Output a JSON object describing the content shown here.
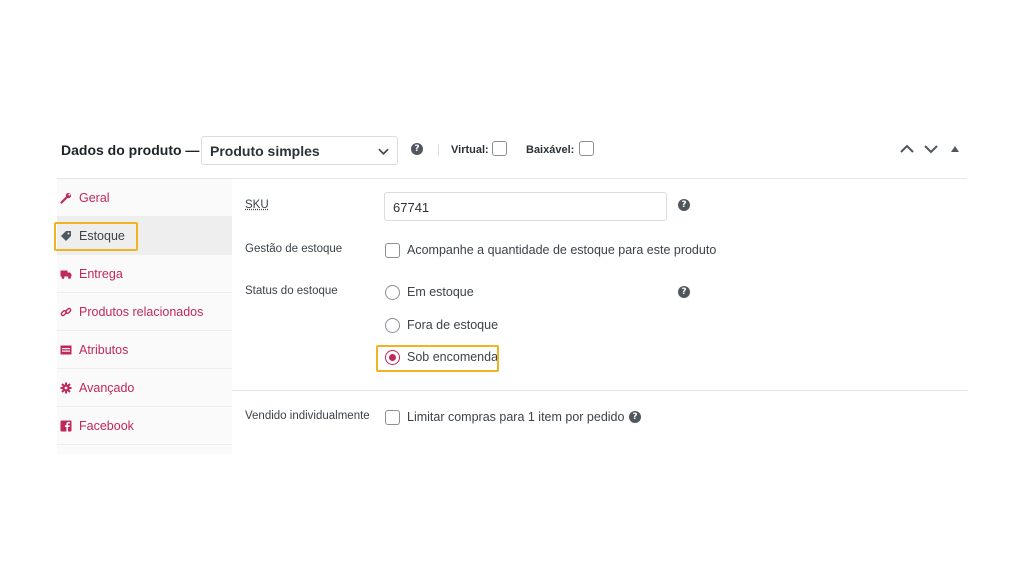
{
  "header": {
    "title": "Dados do produto —",
    "product_type": "Produto simples",
    "virtual_label": "Virtual:",
    "downloadable_label": "Baixável:",
    "help": "?"
  },
  "tabs": [
    {
      "label": "Geral",
      "icon": "wrench-icon",
      "active": false
    },
    {
      "label": "Estoque",
      "icon": "tag-icon",
      "active": true
    },
    {
      "label": "Entrega",
      "icon": "truck-icon",
      "active": false
    },
    {
      "label": "Produtos relacionados",
      "icon": "link-icon",
      "active": false
    },
    {
      "label": "Atributos",
      "icon": "table-icon",
      "active": false
    },
    {
      "label": "Avançado",
      "icon": "gear-icon",
      "active": false
    },
    {
      "label": "Facebook",
      "icon": "facebook-icon",
      "active": false
    }
  ],
  "inventory": {
    "sku_label": "SKU",
    "sku_value": "67741",
    "stock_mgmt_label": "Gestão de estoque",
    "stock_mgmt_text": "Acompanhe a quantidade de estoque para este produto",
    "stock_status_label": "Status do estoque",
    "status_options": [
      "Em estoque",
      "Fora de estoque",
      "Sob encomenda"
    ],
    "selected_status": "Sob encomenda",
    "sold_individually_label": "Vendido individualmente",
    "sold_individually_text": "Limitar compras para 1 item por pedido"
  },
  "colors": {
    "accent": "#c0285b",
    "highlight": "#f0b323"
  }
}
